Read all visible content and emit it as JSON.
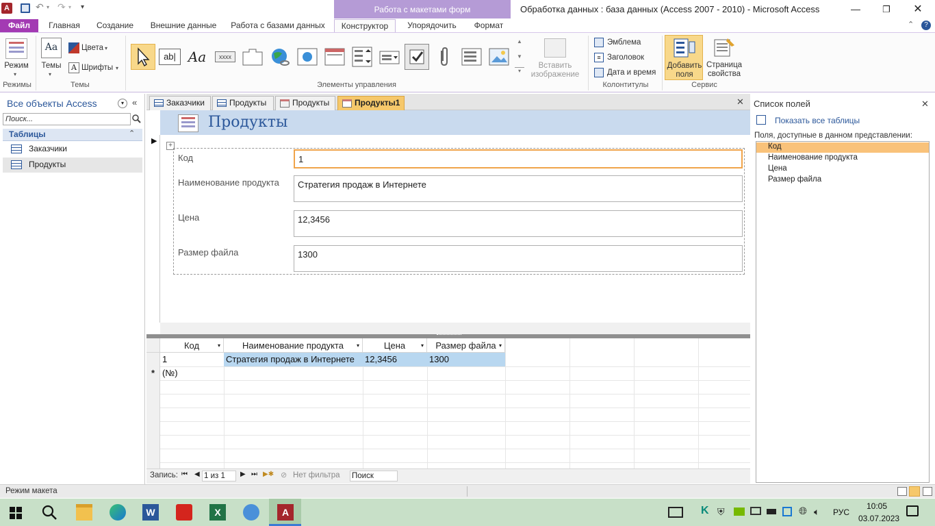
{
  "window": {
    "title": "Обработка данных : база данных (Access 2007 - 2010)  -  Microsoft Access",
    "context_header": "Работа с макетами форм"
  },
  "ribbon_tabs": [
    "Файл",
    "Главная",
    "Создание",
    "Внешние данные",
    "Работа с базами данных",
    "Конструктор",
    "Упорядочить",
    "Формат"
  ],
  "ribbon": {
    "mode_label": "Режим",
    "themes_label": "Темы",
    "colors_label": "Цвета",
    "fonts_label": "Шрифты",
    "insert_image_line1": "Вставить",
    "insert_image_line2": "изображение",
    "logo_label": "Эмблема",
    "title_label": "Заголовок",
    "datetime_label": "Дата и время",
    "add_fields_line1": "Добавить",
    "add_fields_line2": "поля",
    "property_sheet_line1": "Страница",
    "property_sheet_line2": "свойства",
    "groups": {
      "modes": "Режимы",
      "themes": "Темы",
      "controls": "Элементы управления",
      "header_footer": "Колонтитулы",
      "tools": "Сервис"
    },
    "textbox_glyph": "ab|",
    "label_glyph": "Aa",
    "button_glyph": "xxxx"
  },
  "nav": {
    "header": "Все объекты Access",
    "search_placeholder": "Поиск...",
    "section": "Таблицы",
    "items": [
      "Заказчики",
      "Продукты"
    ]
  },
  "doc_tabs": [
    "Заказчики",
    "Продукты",
    "Продукты",
    "Продукты1"
  ],
  "form": {
    "title": "Продукты",
    "fields": [
      {
        "label": "Код",
        "value": "1"
      },
      {
        "label": "Наименование продукта",
        "value": "Стратегия продаж в Интернете"
      },
      {
        "label": "Цена",
        "value": "12,3456"
      },
      {
        "label": "Размер файла",
        "value": "1300"
      }
    ]
  },
  "datasheet": {
    "columns": [
      "Код",
      "Наименование продукта",
      "Цена",
      "Размер файла"
    ],
    "rows": [
      [
        "1",
        "Стратегия продаж в Интернете",
        "12,3456",
        "1300"
      ]
    ],
    "new_row_marker": "*",
    "new_row_text": "(№)"
  },
  "record_nav": {
    "label": "Запись:",
    "position": "1 из 1",
    "filter": "Нет фильтра",
    "search": "Поиск"
  },
  "field_list": {
    "title": "Список полей",
    "show_all": "Показать все таблицы",
    "subtitle": "Поля, доступные в данном представлении:",
    "fields": [
      "Код",
      "Наименование продукта",
      "Цена",
      "Размер файла"
    ]
  },
  "status": {
    "text": "Режим макета"
  },
  "taskbar": {
    "lang": "РУС",
    "time": "10:05",
    "date": "03.07.2023"
  },
  "colors": {
    "accent": "#b59bd6",
    "active_tab": "#f6c86b",
    "selected_field": "#f9c27a",
    "file_tab": "#a33ab3"
  }
}
